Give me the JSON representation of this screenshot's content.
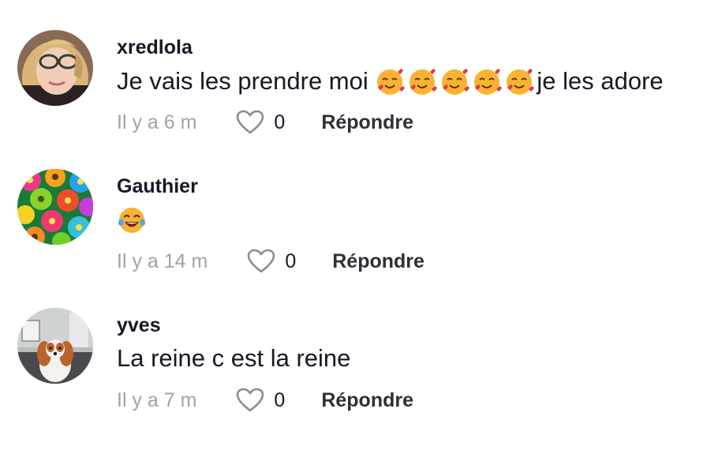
{
  "comments": [
    {
      "username": "xredlola",
      "text_emojis": [
        "smiling-face-with-hearts",
        "smiling-face-with-hearts",
        "smiling-face-with-hearts",
        "smiling-face-with-hearts",
        "smiling-face-with-hearts"
      ],
      "text_before": "Je vais les prendre moi ",
      "text_after": "je les adore",
      "time": "Il y a 6 m",
      "likes": "0",
      "reply_label": "Répondre"
    },
    {
      "username": "Gauthier",
      "text_emojis": [
        "face-with-tears-of-joy"
      ],
      "time": "Il y a 14 m",
      "likes": "0",
      "reply_label": "Répondre"
    },
    {
      "username": "yves",
      "text": "La reine c est la reine",
      "time": "Il y a 7 m",
      "likes": "0",
      "reply_label": "Répondre"
    }
  ],
  "icons": {
    "like": "heart-outline-icon"
  },
  "colors": {
    "text_primary": "#161823",
    "text_secondary": "#a1a2a7",
    "reply": "#2f3036"
  }
}
